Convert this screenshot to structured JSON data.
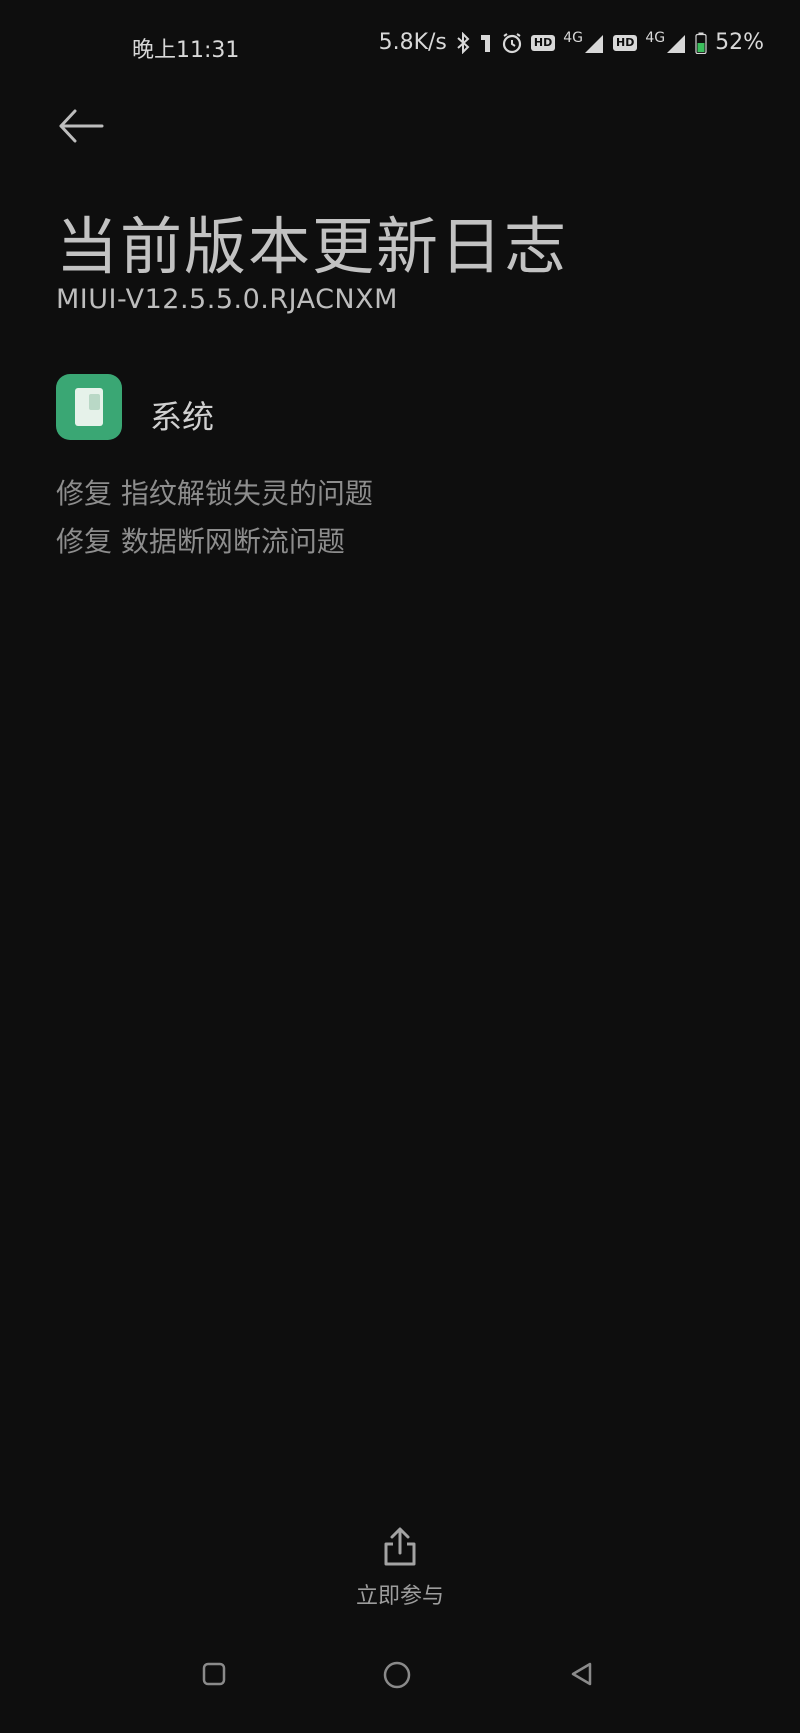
{
  "status_bar": {
    "time": "晚上11:31",
    "net_speed": "5.8K/s",
    "sim1_type": "4G",
    "sim2_type": "4G",
    "hd_label": "HD",
    "battery": "52%",
    "icons": [
      "bluetooth-icon",
      "key-icon",
      "alarm-icon",
      "hd-icon",
      "signal-icon",
      "hd-icon",
      "signal-icon",
      "battery-icon"
    ]
  },
  "header": {
    "back_icon": "back-arrow-icon",
    "title": "当前版本更新日志",
    "version": "MIUI-V12.5.5.0.RJACNXM"
  },
  "section": {
    "icon": "system-app-icon",
    "label": "系统",
    "items": [
      "修复 指纹解锁失灵的问题",
      "修复 数据断网断流问题"
    ]
  },
  "footer": {
    "share_icon": "share-icon",
    "participate_label": "立即参与"
  },
  "nav_bar": {
    "icons": [
      "recents-icon",
      "home-icon",
      "back-icon"
    ]
  },
  "colors": {
    "background": "#0e0e0e",
    "accent_green": "#3aa774",
    "text_primary": "#c2c2c2",
    "text_secondary": "#8d8d8d"
  }
}
